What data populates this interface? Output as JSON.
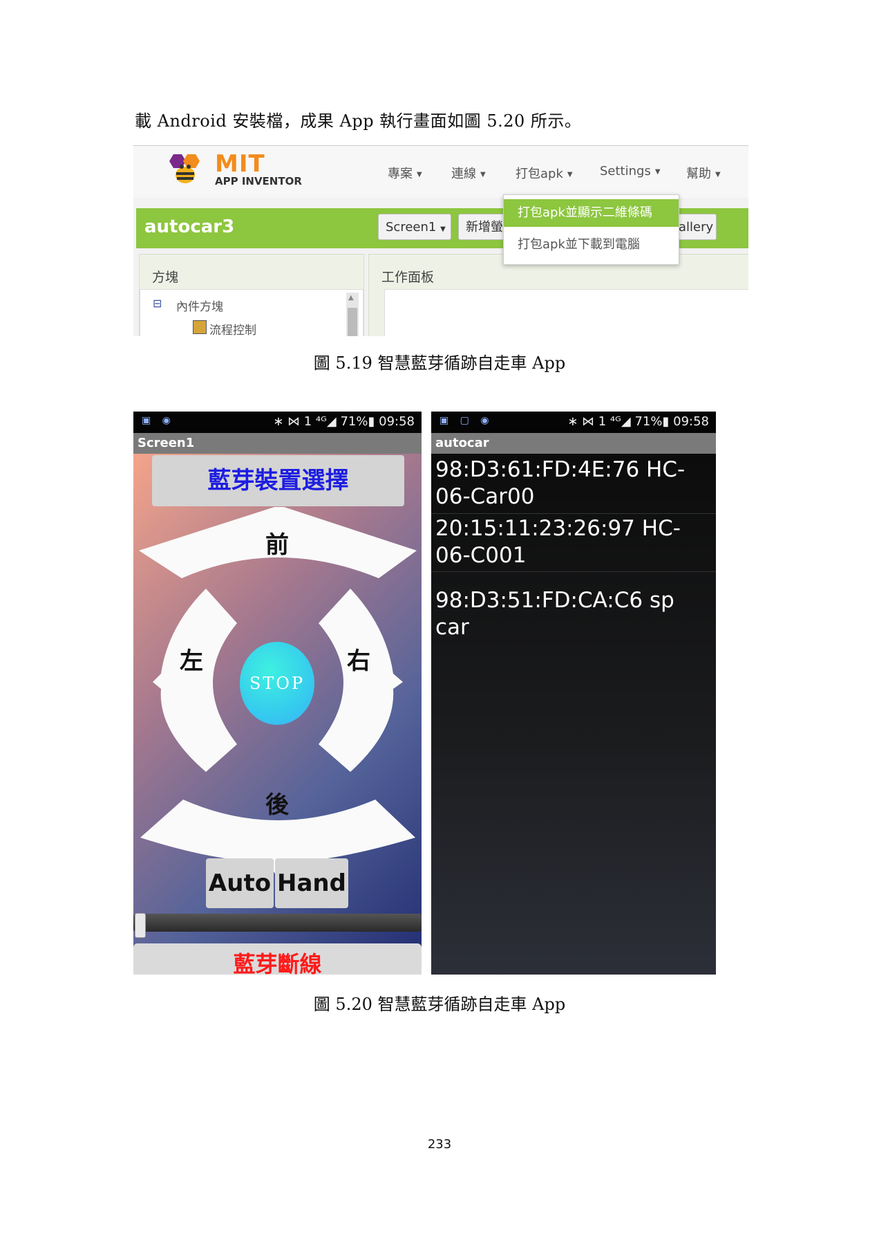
{
  "intro_text": "載 Android 安裝檔，成果 App 執行畫面如圖 5.20 所示。",
  "fig519": {
    "logo_text": "MIT",
    "logo_sub": "APP INVENTOR",
    "menu": [
      "專案",
      "連線",
      "打包apk",
      "Settings",
      "幫助"
    ],
    "project_name": "autocar3",
    "screen_btn": "Screen1",
    "add_screen_btn": "新增螢",
    "gallery_btn": "allery",
    "dropdown_items": [
      "打包apk並顯示二維條碼",
      "打包apk並下載到電腦"
    ],
    "blocks_panel_title": "方塊",
    "builtin_label": "內件方塊",
    "control_label": "流程控制",
    "viewer_title": "工作面板",
    "accent_color": "#8dc63f",
    "caption": "圖 5.19 智慧藍芽循跡自走車 App"
  },
  "fig520": {
    "phone1": {
      "status_left": "▣ ◉",
      "status_right": "∗ ⋈ 1 ⁴ᴳ◢ 71%▮ 09:58",
      "title": "Screen1",
      "select_button": "藍芽裝置選擇",
      "forward": "前",
      "left": "左",
      "stop": "STOP",
      "right": "右",
      "back": "後",
      "auto": "Auto",
      "hand": "Hand",
      "slider_value": 0,
      "disconnect": "藍芽斷線"
    },
    "phone2": {
      "status_left": "▣ ▢ ◉",
      "status_right": "∗ ⋈ 1 ⁴ᴳ◢ 71%▮ 09:58",
      "title": "autocar",
      "devices": [
        "98:D3:61:FD:4E:76 HC-06-Car00",
        "20:15:11:23:26:97 HC-06-C001",
        "98:D3:51:FD:CA:C6 sp car"
      ]
    },
    "caption": "圖 5.20 智慧藍芽循跡自走車 App"
  },
  "page_number": "233"
}
